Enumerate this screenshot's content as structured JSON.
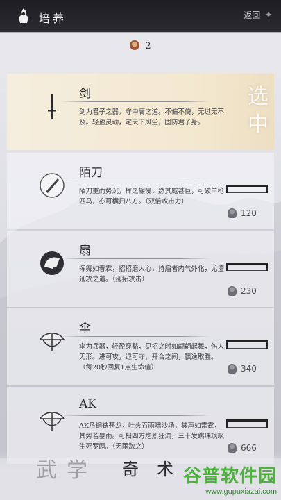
{
  "header": {
    "title": "培养",
    "back_label": "返回"
  },
  "points": {
    "value": "2"
  },
  "skills": [
    {
      "name": "剑",
      "desc": "剑为君子之器，守中庸之道。不偏不倚，无过无不及。轻盈灵动，定天下风尘，固防君子身。",
      "cost": "",
      "selected": true
    },
    {
      "name": "陌刀",
      "desc": "陌刀重而势沉，挥之辗慢，然其威甚巨，可破羊枪匹马，亦可横扫八方。（双倍攻击力）",
      "cost": "120"
    },
    {
      "name": "扇",
      "desc": "挥舞如春霖，招招磨人心，持扇者内气外化，尤擅延攻之道。（延拓攻击）",
      "cost": "230"
    },
    {
      "name": "伞",
      "desc": "伞为兵器，轻盈穿豁，见招之时如翩翩起舞，伤人无形。进可攻，退可守，开合之间，飘逸取胜。（每20秒回复1点生命值）",
      "cost": "340"
    },
    {
      "name": "AK",
      "desc": "AK乃钢铁苍龙，吐火吞雨啸沙场，其声如雷霆，其势若暴雨。可扫四方炮烈狂流，三十发跳珠飒飒生死罗网。（无雨敌之）",
      "cost": "666"
    }
  ],
  "selected_mark": "选中",
  "bottom": {
    "left": "武学",
    "right": "奇术"
  },
  "watermark": {
    "main": "谷普软件园",
    "url": "www.gupuxiazai.com"
  }
}
